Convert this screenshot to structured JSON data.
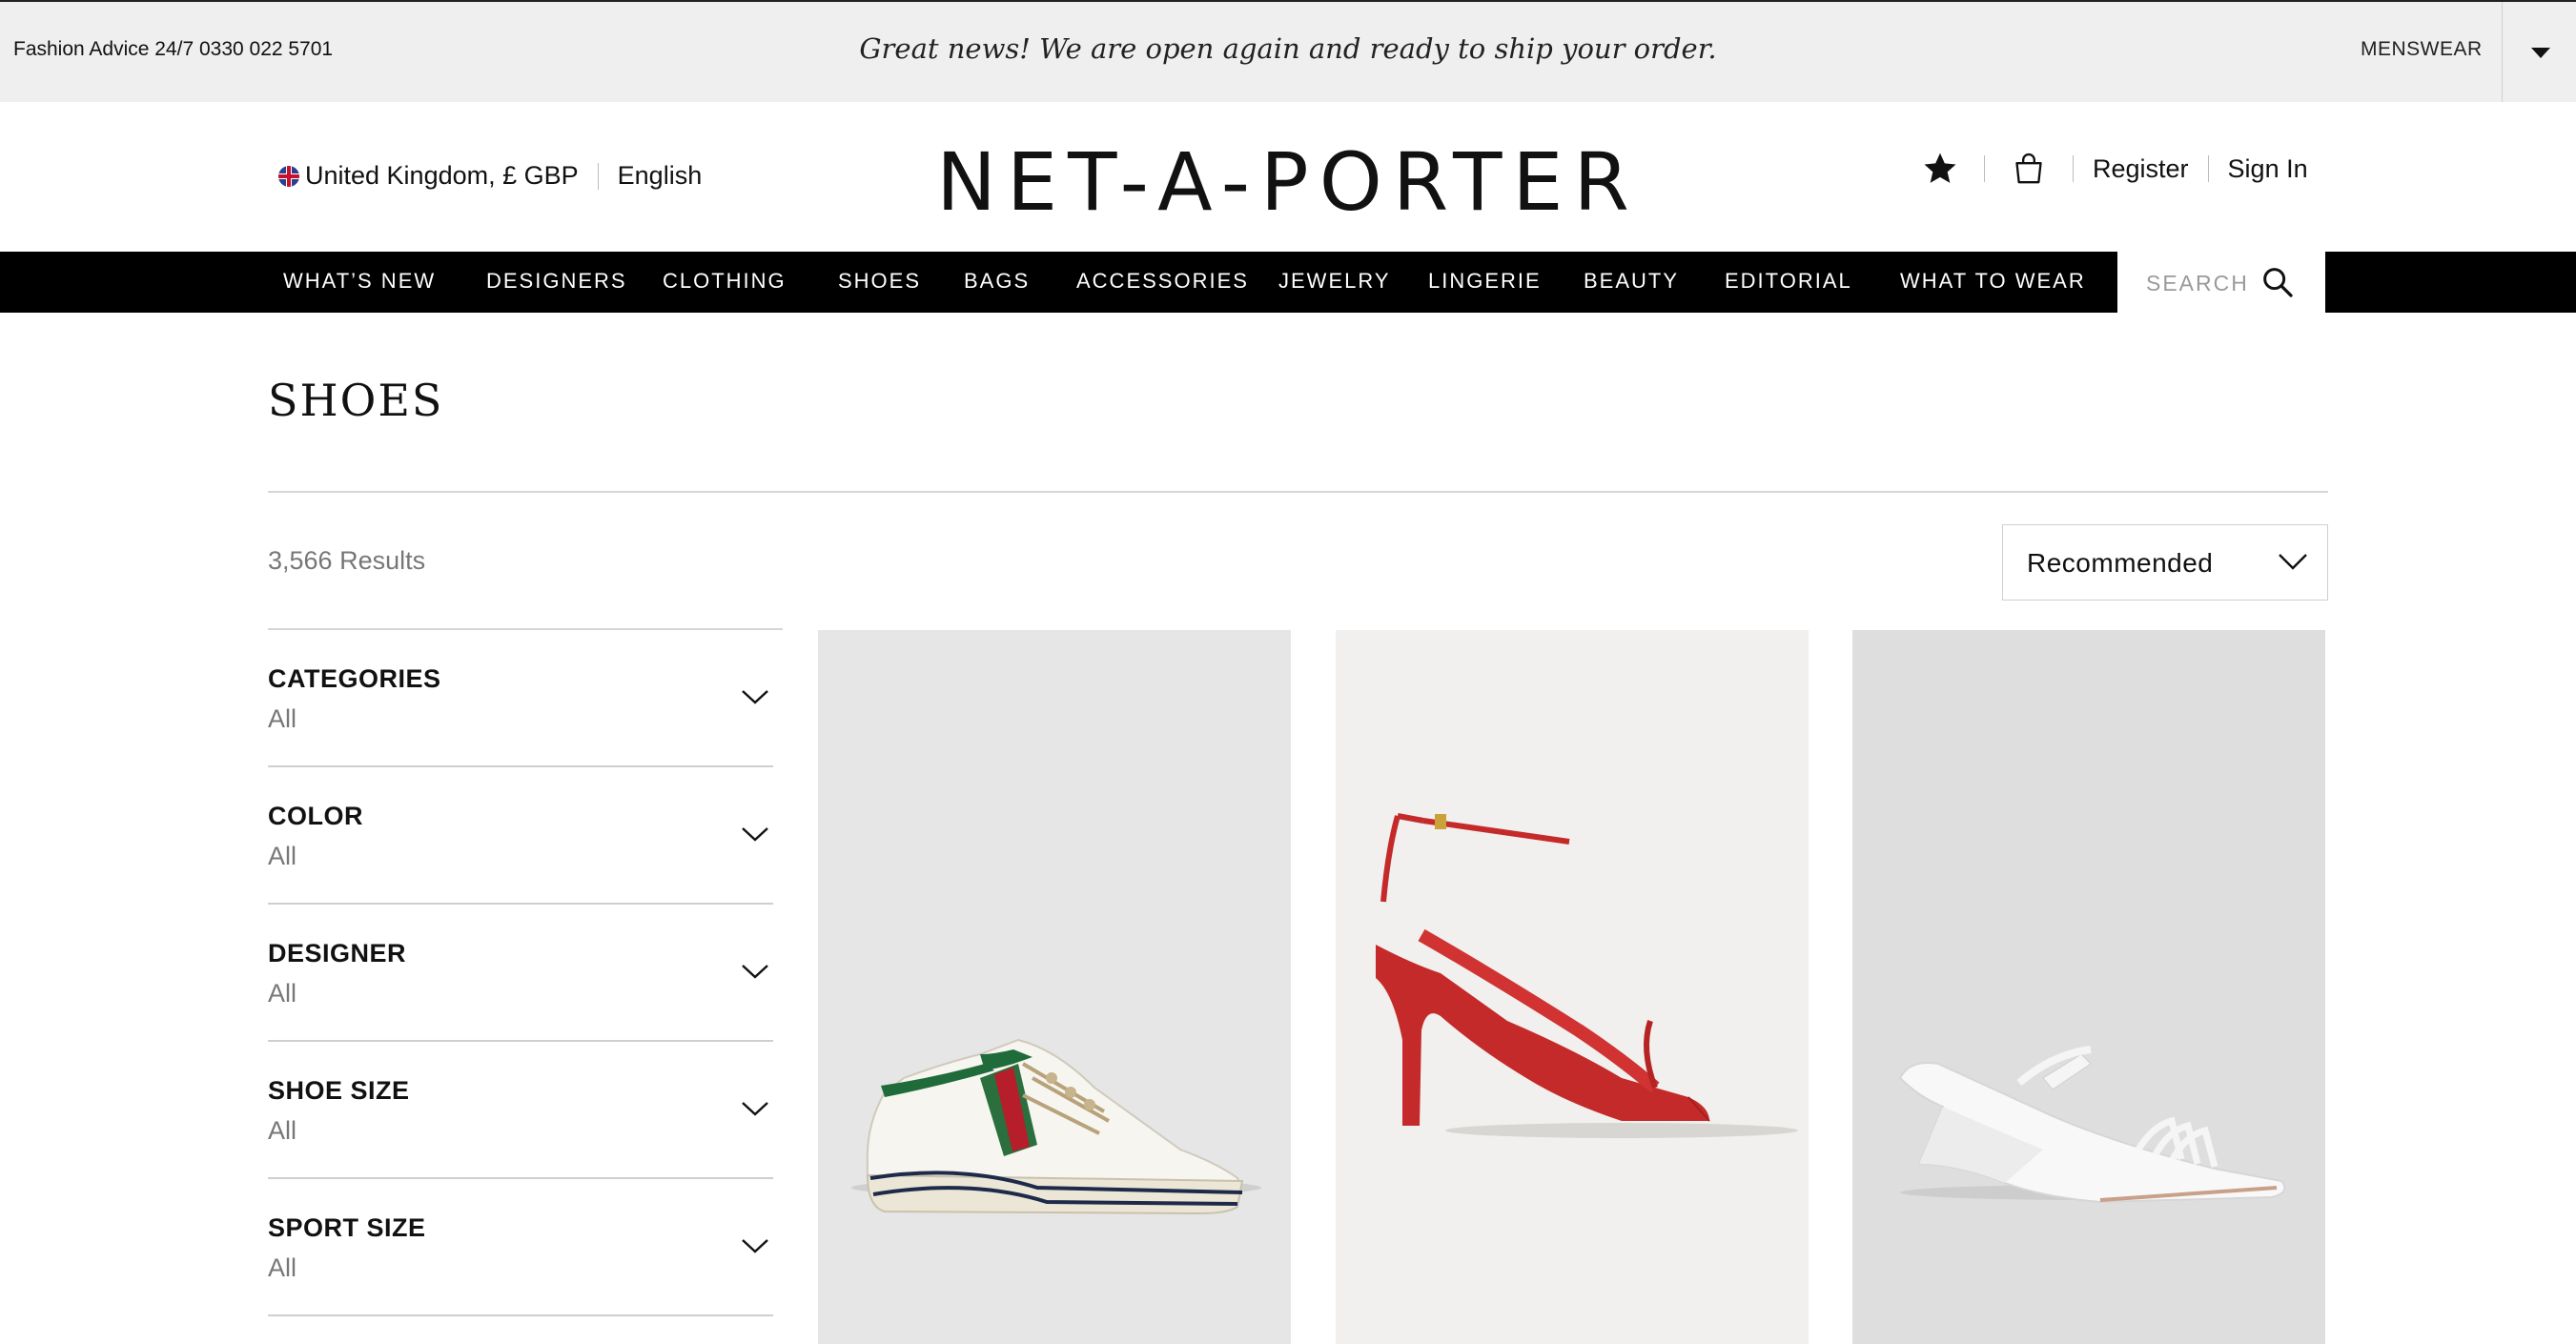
{
  "top_bar": {
    "advice": "Fashion Advice 24/7 0330 022 5701",
    "promo": "Great news! We are open again and ready to ship your order.",
    "menswear": "MENSWEAR"
  },
  "header": {
    "region": "United Kingdom, £ GBP",
    "language": "English",
    "logo": "NET-A-PORTER",
    "register": "Register",
    "sign_in": "Sign In"
  },
  "nav": {
    "items": [
      "WHAT’S NEW",
      "DESIGNERS",
      "CLOTHING",
      "SHOES",
      "BAGS",
      "ACCESSORIES",
      "JEWELRY",
      "LINGERIE",
      "BEAUTY",
      "EDITORIAL",
      "WHAT TO WEAR"
    ],
    "search_placeholder": "SEARCH"
  },
  "page": {
    "title": "SHOES",
    "results": "3,566 Results",
    "sort_label": "Recommended"
  },
  "filters": [
    {
      "name": "CATEGORIES",
      "value": "All"
    },
    {
      "name": "COLOR",
      "value": "All"
    },
    {
      "name": "DESIGNER",
      "value": "All"
    },
    {
      "name": "SHOE SIZE",
      "value": "All"
    },
    {
      "name": "SPORT SIZE",
      "value": "All"
    }
  ],
  "products": [
    {
      "background": "#e6e6e6",
      "item": "white canvas sneaker with green and red stripe"
    },
    {
      "background": "#f1f0ee",
      "item": "red leather thong sandal with ankle strap"
    },
    {
      "background": "#dedede",
      "item": "white sculptural wedge sandal"
    }
  ],
  "icons": {
    "wishlist": "star-icon",
    "bag": "shopping-bag-icon",
    "search": "search-icon",
    "chevron": "chevron-down-icon",
    "dropdown": "caret-down-icon",
    "flag": "uk-flag-icon"
  }
}
